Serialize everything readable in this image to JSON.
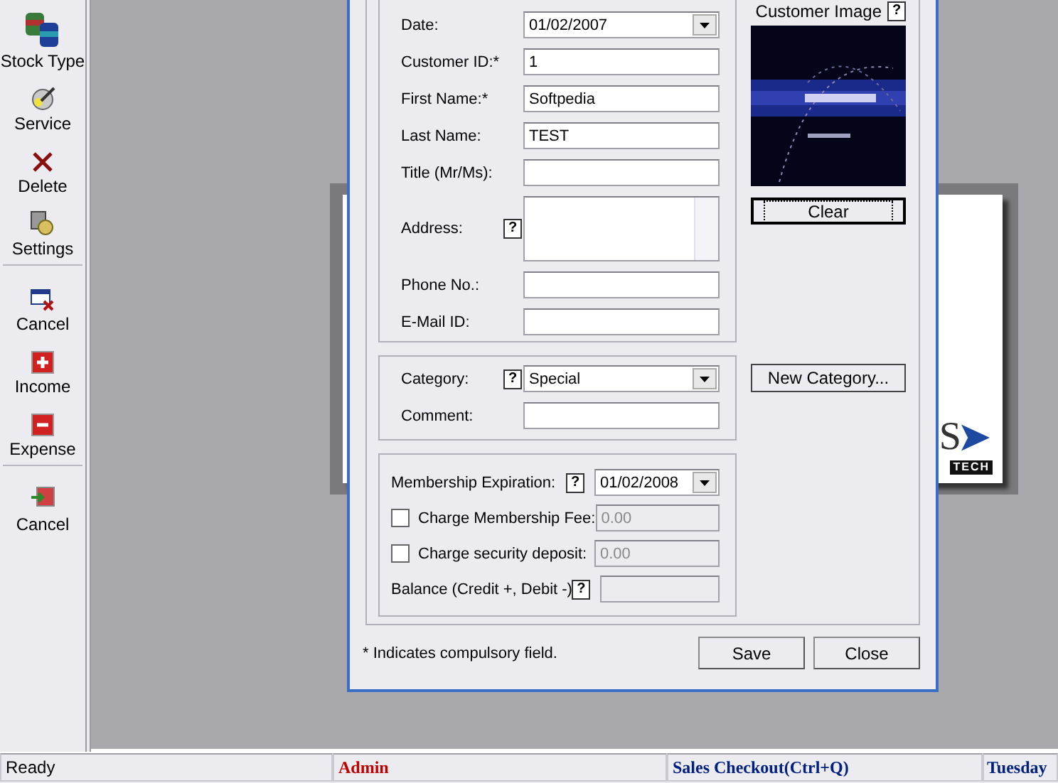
{
  "toolbar": [
    {
      "label": "Stock Type",
      "kind": "button"
    },
    {
      "label": "Service",
      "kind": "button"
    },
    {
      "label": "Delete",
      "kind": "button"
    },
    {
      "label": "Settings",
      "kind": "button"
    },
    {
      "kind": "separator"
    },
    {
      "label": "Cancel",
      "kind": "button"
    },
    {
      "label": "Income",
      "kind": "button"
    },
    {
      "label": "Expense",
      "kind": "button"
    },
    {
      "kind": "separator"
    },
    {
      "label": "Cancel",
      "kind": "button"
    }
  ],
  "background_document": {
    "logo_letter": "S",
    "logo_tagline": "TECH"
  },
  "dialog": {
    "customer_group": [
      {
        "label": "Date:",
        "kind": "dropdown",
        "value": "01/02/2007"
      },
      {
        "label": "Customer ID:*",
        "kind": "text",
        "value": "1"
      },
      {
        "label": "First Name:*",
        "kind": "text",
        "value": "Softpedia"
      },
      {
        "label": "Last Name:",
        "kind": "text",
        "value": "TEST"
      },
      {
        "label": "Title (Mr/Ms):",
        "kind": "text"
      },
      {
        "label": "Address:",
        "kind": "textarea",
        "help": "?"
      },
      {
        "label": "Phone No.:",
        "kind": "text"
      },
      {
        "label": "E-Mail ID:",
        "kind": "text"
      }
    ],
    "category_group": [
      {
        "label": "Category:",
        "kind": "dropdown",
        "value": "Special",
        "help": "?"
      },
      {
        "label": "Comment:",
        "kind": "text"
      }
    ],
    "membership_group": [
      {
        "label": "Membership Expiration:",
        "kind": "dropdown",
        "value": "01/02/2008",
        "help": "?"
      },
      {
        "label": "Charge Membership Fee:",
        "kind": "checkbox",
        "checked": false,
        "value": "0.00"
      },
      {
        "label": "Charge security deposit:",
        "kind": "checkbox",
        "checked": false,
        "value": "0.00"
      },
      {
        "label": "Balance (Credit +, Debit -)",
        "kind": "readonly",
        "help": "?"
      }
    ],
    "customer_image": {
      "label": "Customer Image",
      "help": "?",
      "kind": "picture"
    },
    "clear_button": "Clear",
    "new_category_button": "New Category...",
    "note": "* Indicates compulsory field.",
    "buttons": [
      "Save",
      "Close"
    ]
  },
  "status_bar": [
    {
      "text": "Ready",
      "kind": "plain"
    },
    {
      "text": "Admin",
      "kind": "user"
    },
    {
      "text": "Sales Checkout(Ctrl+Q)",
      "kind": "shortcut"
    },
    {
      "text": "Tuesday",
      "kind": "date"
    }
  ]
}
